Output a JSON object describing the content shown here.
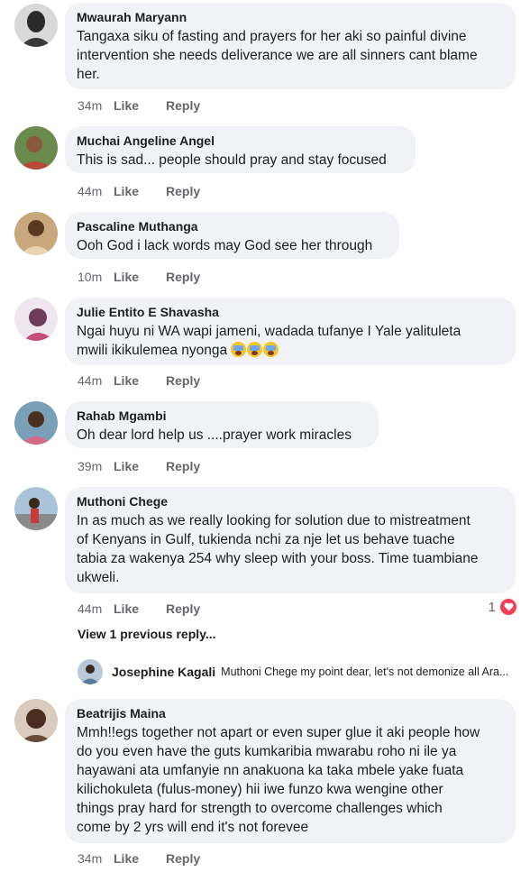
{
  "comments": [
    {
      "name": "Mwaurah Maryann",
      "lines": [
        "Tangaxa siku of fasting and prayers for her aki so painful divine",
        "intervention she needs deliverance we are all sinners cant blame",
        "her."
      ],
      "time": "34m",
      "like": "Like",
      "reply": "Reply"
    },
    {
      "name": "Muchai Angeline Angel",
      "lines": [
        "This is sad... people should pray and stay focused"
      ],
      "time": "44m",
      "like": "Like",
      "reply": "Reply"
    },
    {
      "name": "Pascaline Muthanga",
      "lines": [
        "Ooh God i lack words may God see her through"
      ],
      "time": "10m",
      "like": "Like",
      "reply": "Reply"
    },
    {
      "name": "Julie Entito E Shavasha",
      "lines": [
        "Ngai huyu ni WA wapi jameni, wadada tufanye I Yale yalituleta",
        "mwili ikikulemea nyonga"
      ],
      "time": "44m",
      "like": "Like",
      "reply": "Reply"
    },
    {
      "name": "Rahab Mgambi",
      "lines": [
        "Oh dear lord help us ....prayer work miracles"
      ],
      "time": "39m",
      "like": "Like",
      "reply": "Reply"
    },
    {
      "name": "Muthoni Chege",
      "lines": [
        "In as much as we really looking for solution due to mistreatment",
        "of Kenyans in Gulf, tukienda nchi za nje let us behave tuache",
        "tabia za wakenya 254 why sleep with your boss.  Time tuambiane",
        "ukweli."
      ],
      "time": "44m",
      "like": "Like",
      "reply": "Reply",
      "reaction_count": "1"
    },
    {
      "name": "Beatrijis Maina",
      "lines": [
        "Mmh!!egs together not apart or even super glue it aki people how",
        "do you even have the guts kumkaribia mwarabu roho ni ile ya",
        "hayawani ata umfanyie nn anakuona ka taka mbele yake fuata",
        "kilichokuleta (fulus-money) hii iwe funzo kwa wengine other",
        "things pray hard for strength to overcome challenges which",
        "come by 2 yrs will end it's not forevee"
      ],
      "time": "34m",
      "like": "Like",
      "reply": "Reply"
    }
  ],
  "view_previous": "View 1 previous reply...",
  "reply_preview": {
    "name": "Josephine Kagali",
    "text": "Muthoni Chege my point dear, let's not demonize all Ara..."
  },
  "colors": {
    "bubble": "#f0f2f5",
    "meta": "#65676b",
    "heart": "#f33e58"
  }
}
